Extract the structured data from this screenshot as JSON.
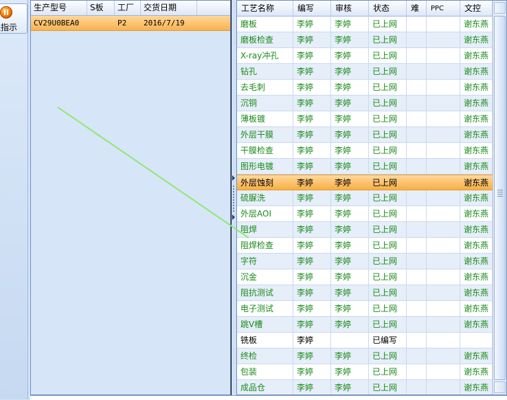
{
  "toolbar": {
    "label": "程指示",
    "icon": "pause-icon"
  },
  "order_grid": {
    "columns": [
      "生产型号",
      "S板",
      "工厂",
      "交货日期"
    ],
    "rows": [
      {
        "model": "CV29U0BEA0",
        "s_board": "",
        "factory": "P2",
        "delivery_date": "2016/7/19"
      }
    ]
  },
  "process_grid": {
    "columns": [
      "工艺名称",
      "编写",
      "审核",
      "状态",
      "难",
      "PPC",
      "文控"
    ],
    "selected_index": 10,
    "rows": [
      {
        "name": "磨板",
        "writer": "李婷",
        "reviewer": "李婷",
        "status": "已上网",
        "difficulty": "",
        "ppc": "",
        "doc_control": "谢东燕"
      },
      {
        "name": "磨板检查",
        "writer": "李婷",
        "reviewer": "李婷",
        "status": "已上网",
        "difficulty": "",
        "ppc": "",
        "doc_control": "谢东燕"
      },
      {
        "name": "X-ray冲孔",
        "writer": "李婷",
        "reviewer": "李婷",
        "status": "已上网",
        "difficulty": "",
        "ppc": "",
        "doc_control": "谢东燕"
      },
      {
        "name": "钻孔",
        "writer": "李婷",
        "reviewer": "李婷",
        "status": "已上网",
        "difficulty": "",
        "ppc": "",
        "doc_control": "谢东燕"
      },
      {
        "name": "去毛刺",
        "writer": "李婷",
        "reviewer": "李婷",
        "status": "已上网",
        "difficulty": "",
        "ppc": "",
        "doc_control": "谢东燕"
      },
      {
        "name": "沉铜",
        "writer": "李婷",
        "reviewer": "李婷",
        "status": "已上网",
        "difficulty": "",
        "ppc": "",
        "doc_control": "谢东燕"
      },
      {
        "name": "薄板镀",
        "writer": "李婷",
        "reviewer": "李婷",
        "status": "已上网",
        "difficulty": "",
        "ppc": "",
        "doc_control": "谢东燕"
      },
      {
        "name": "外层干膜",
        "writer": "李婷",
        "reviewer": "李婷",
        "status": "已上网",
        "difficulty": "",
        "ppc": "",
        "doc_control": "谢东燕"
      },
      {
        "name": "干膜检查",
        "writer": "李婷",
        "reviewer": "李婷",
        "status": "已上网",
        "difficulty": "",
        "ppc": "",
        "doc_control": "谢东燕"
      },
      {
        "name": "图形电镀",
        "writer": "李婷",
        "reviewer": "李婷",
        "status": "已上网",
        "difficulty": "",
        "ppc": "",
        "doc_control": "谢东燕"
      },
      {
        "name": "外层蚀刻",
        "writer": "李婷",
        "reviewer": "李婷",
        "status": "已上网",
        "difficulty": "",
        "ppc": "",
        "doc_control": "谢东燕"
      },
      {
        "name": "硫脲洗",
        "writer": "李婷",
        "reviewer": "李婷",
        "status": "已上网",
        "difficulty": "",
        "ppc": "",
        "doc_control": "谢东燕"
      },
      {
        "name": "外层AOI",
        "writer": "李婷",
        "reviewer": "李婷",
        "status": "已上网",
        "difficulty": "",
        "ppc": "",
        "doc_control": "谢东燕"
      },
      {
        "name": "阻焊",
        "writer": "李婷",
        "reviewer": "李婷",
        "status": "已上网",
        "difficulty": "",
        "ppc": "",
        "doc_control": "谢东燕"
      },
      {
        "name": "阻焊检查",
        "writer": "李婷",
        "reviewer": "李婷",
        "status": "已上网",
        "difficulty": "",
        "ppc": "",
        "doc_control": "谢东燕"
      },
      {
        "name": "字符",
        "writer": "李婷",
        "reviewer": "李婷",
        "status": "已上网",
        "difficulty": "",
        "ppc": "",
        "doc_control": "谢东燕"
      },
      {
        "name": "沉金",
        "writer": "李婷",
        "reviewer": "李婷",
        "status": "已上网",
        "difficulty": "",
        "ppc": "",
        "doc_control": "谢东燕"
      },
      {
        "name": "阻抗测试",
        "writer": "李婷",
        "reviewer": "李婷",
        "status": "已上网",
        "difficulty": "",
        "ppc": "",
        "doc_control": "谢东燕"
      },
      {
        "name": "电子测试",
        "writer": "李婷",
        "reviewer": "李婷",
        "status": "已上网",
        "difficulty": "",
        "ppc": "",
        "doc_control": "谢东燕"
      },
      {
        "name": "跳V槽",
        "writer": "李婷",
        "reviewer": "李婷",
        "status": "已上网",
        "difficulty": "",
        "ppc": "",
        "doc_control": "谢东燕"
      },
      {
        "name": "铣板",
        "writer": "李婷",
        "reviewer": "",
        "status": "已编写",
        "difficulty": "",
        "ppc": "",
        "doc_control": ""
      },
      {
        "name": "终检",
        "writer": "李婷",
        "reviewer": "李婷",
        "status": "已上网",
        "difficulty": "",
        "ppc": "",
        "doc_control": "谢东燕"
      },
      {
        "name": "包装",
        "writer": "李婷",
        "reviewer": "李婷",
        "status": "已上网",
        "difficulty": "",
        "ppc": "",
        "doc_control": "谢东燕"
      },
      {
        "name": "成品仓",
        "writer": "李婷",
        "reviewer": "李婷",
        "status": "已上网",
        "difficulty": "",
        "ppc": "",
        "doc_control": "谢东燕"
      }
    ]
  },
  "colors": {
    "approved_text": "#1a8a1a",
    "selected_row": "#f8ae45",
    "annotation_arrow": "#90e870"
  }
}
